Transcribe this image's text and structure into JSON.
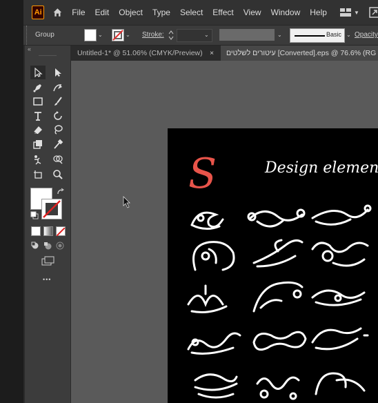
{
  "app": {
    "logo": "Ai",
    "home_icon": "home-icon"
  },
  "menu": [
    "File",
    "Edit",
    "Object",
    "Type",
    "Select",
    "Effect",
    "View",
    "Window",
    "Help"
  ],
  "control_bar": {
    "selection_type": "Group",
    "stroke_label": "Stroke:",
    "brush_label": "Basic",
    "opacity_label": "Opacity"
  },
  "tabs": [
    {
      "label": "Untitled-1* @ 51.06% (CMYK/Preview)",
      "close": "×",
      "active": false
    },
    {
      "label": "עיטורים לשלטים [Converted].eps @ 76.6% (RG",
      "active": true
    }
  ],
  "toolbar": {
    "collapse_label": "«",
    "more_label": "•••",
    "tools": [
      "selection-tool",
      "direct-selection-tool",
      "pen-tool",
      "curvature-tool",
      "rectangle-tool",
      "paintbrush-tool",
      "type-tool",
      "rotate-tool",
      "eraser-tool",
      "lasso-tool",
      "scale-tool",
      "eyedropper-tool",
      "puppet-warp-tool",
      "shape-builder-tool",
      "artboard-tool",
      "zoom-tool"
    ],
    "fill_color": "#ffffff",
    "stroke_color": "none"
  },
  "artwork": {
    "monogram": "S",
    "heading": "Design elements. S",
    "monogram_color": "#e8544a",
    "background": "#000000"
  },
  "colors": {
    "menubar": "#323232",
    "control_bar": "#3b3b3b",
    "canvas": "#5a5a5a",
    "toolbar": "#3c3c3c"
  }
}
